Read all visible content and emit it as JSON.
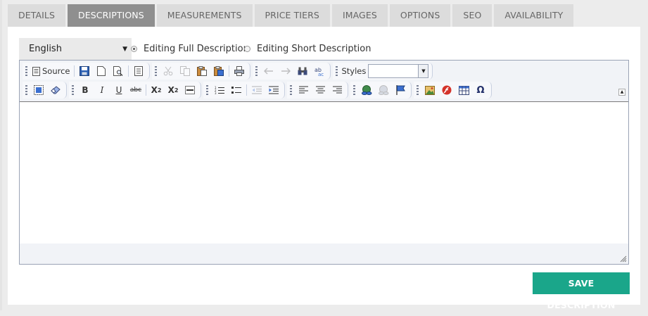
{
  "tabs": [
    {
      "label": "DETAILS",
      "active": false
    },
    {
      "label": "DESCRIPTIONS",
      "active": true
    },
    {
      "label": "MEASUREMENTS",
      "active": false
    },
    {
      "label": "PRICE TIERS",
      "active": false
    },
    {
      "label": "IMAGES",
      "active": false
    },
    {
      "label": "OPTIONS",
      "active": false
    },
    {
      "label": "SEO",
      "active": false
    },
    {
      "label": "AVAILABILITY",
      "active": false
    }
  ],
  "language": {
    "selected": "English"
  },
  "description_mode": {
    "full_label": "Editing Full Description",
    "short_label": "Editing Short Description",
    "selected": "full"
  },
  "editor": {
    "source_label": "Source",
    "styles_label": "Styles",
    "styles_value": "",
    "content": ""
  },
  "actions": {
    "save_label": "SAVE DESCRIPTION"
  },
  "colors": {
    "accent": "#1aa68a",
    "active_tab": "#8f8f8f",
    "tab": "#dcdcdc"
  }
}
